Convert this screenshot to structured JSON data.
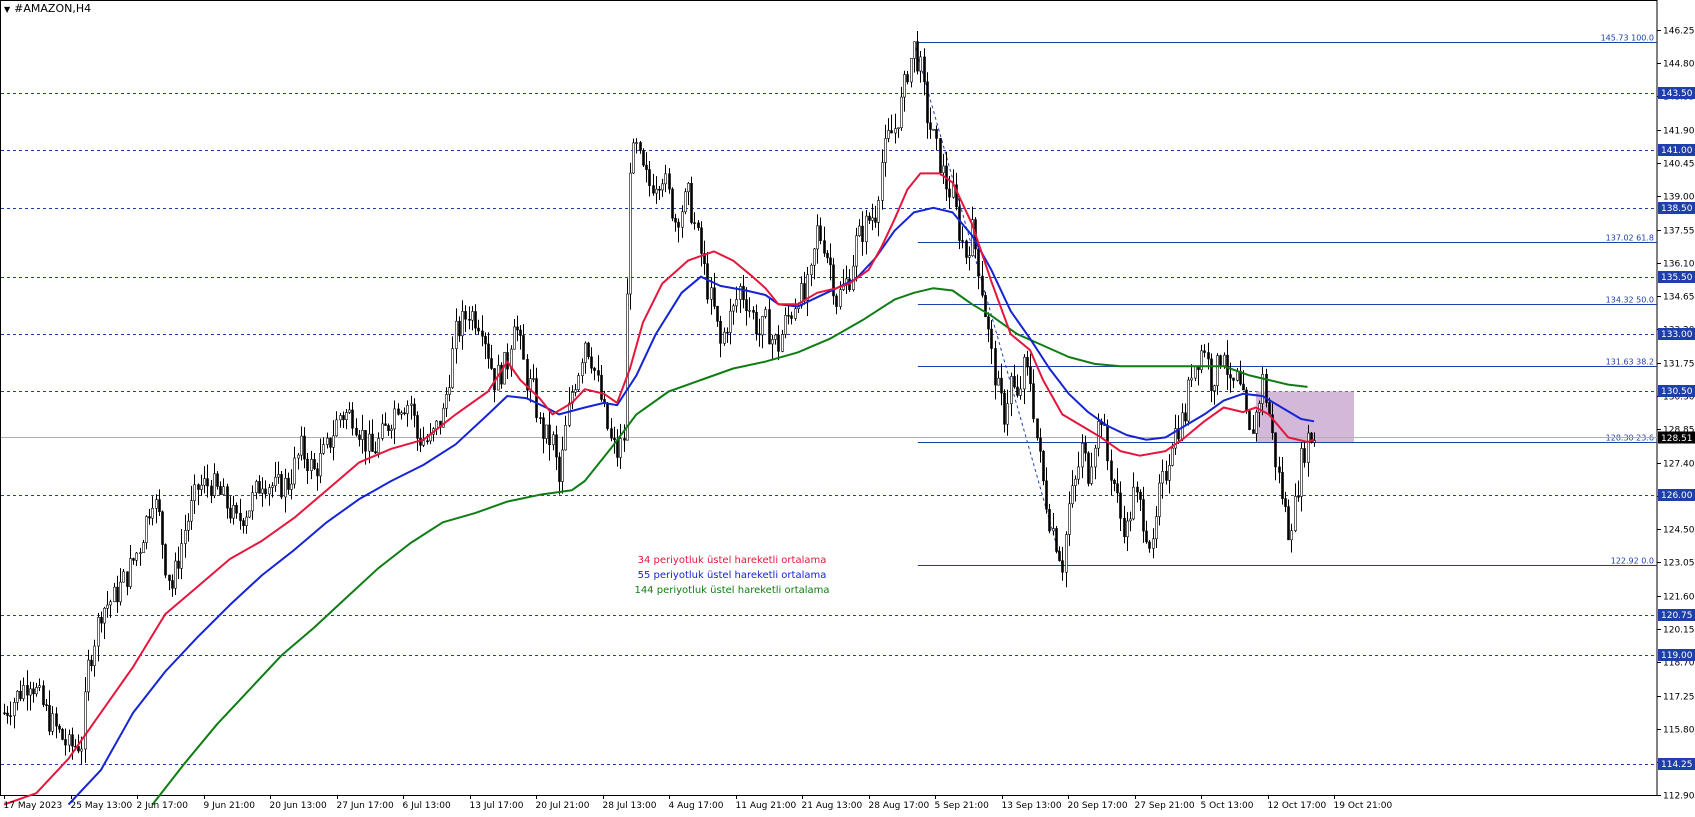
{
  "window": {
    "title": "#AMAZON,H4"
  },
  "chart_data": {
    "type": "candlestick",
    "symbol": "#AMAZON",
    "timeframe": "H4",
    "colors": {
      "ema34": "#e5163c",
      "ema55": "#1524d4",
      "ema144": "#0f7d14",
      "level": "#1f3fa8",
      "fib": "#1f3fa8",
      "zone": "#c9a6cf",
      "candle": "#000000",
      "current_price": "#ffffff"
    },
    "ylim": [
      112.92,
      146.9
    ],
    "y_ticks": [
      "146.25",
      "144.80",
      "143.35",
      "141.90",
      "140.45",
      "139.00",
      "137.55",
      "136.10",
      "134.65",
      "133.20",
      "131.75",
      "130.30",
      "128.85",
      "127.40",
      "125.95",
      "124.50",
      "123.05",
      "121.60",
      "120.15",
      "118.70",
      "117.25",
      "115.80",
      "114.35",
      "112.90"
    ],
    "x_ticks": [
      "17 May 2023",
      "25 May 13:00",
      "2 Jun 17:00",
      "9 Jun 21:00",
      "20 Jun 13:00",
      "27 Jun 17:00",
      "6 Jul 13:00",
      "13 Jul 17:00",
      "20 Jul 21:00",
      "28 Jul 13:00",
      "4 Aug 17:00",
      "11 Aug 21:00",
      "21 Aug 13:00",
      "28 Aug 17:00",
      "5 Sep 21:00",
      "13 Sep 13:00",
      "20 Sep 17:00",
      "27 Sep 21:00",
      "5 Oct 13:00",
      "12 Oct 17:00",
      "19 Oct 21:00"
    ],
    "horizontal_levels": [
      "143.50",
      "141.00",
      "138.50",
      "135.50",
      "133.00",
      "130.50",
      "126.00",
      "120.75",
      "119.00",
      "114.25"
    ],
    "fibonacci": [
      {
        "label": "145.73 100.0",
        "price": 145.73
      },
      {
        "label": "137.02 61.8",
        "price": 137.02
      },
      {
        "label": "134.32 50.0",
        "price": 134.32
      },
      {
        "label": "131.63 38.2",
        "price": 131.63
      },
      {
        "label": "128.30 23.6",
        "price": 128.3
      },
      {
        "label": "122.92 0.0",
        "price": 122.92
      }
    ],
    "current_price": "128.51",
    "legend": [
      {
        "text": "34 periyotluk üstel hareketli ortalama",
        "color": "#e5163c"
      },
      {
        "text": "55 periyotluk üstel hareketli ortalama",
        "color": "#1524d4"
      },
      {
        "text": "144 periyotluk üstel hareketli ortalama",
        "color": "#0f7d14"
      }
    ],
    "close_path": [
      [
        0,
        116.5
      ],
      [
        8,
        118.0
      ],
      [
        14,
        116.2
      ],
      [
        20,
        115.0
      ],
      [
        24,
        115.2
      ],
      [
        26,
        118.5
      ],
      [
        30,
        121.0
      ],
      [
        34,
        121.5
      ],
      [
        38,
        122.5
      ],
      [
        42,
        123.8
      ],
      [
        46,
        126.0
      ],
      [
        48,
        125.0
      ],
      [
        50,
        123.0
      ],
      [
        52,
        122.0
      ],
      [
        56,
        124.5
      ],
      [
        60,
        126.3
      ],
      [
        64,
        126.5
      ],
      [
        68,
        125.8
      ],
      [
        72,
        124.8
      ],
      [
        76,
        125.5
      ],
      [
        80,
        126.7
      ],
      [
        84,
        126.3
      ],
      [
        88,
        126.5
      ],
      [
        92,
        128.0
      ],
      [
        96,
        127.0
      ],
      [
        100,
        128.0
      ],
      [
        104,
        129.5
      ],
      [
        108,
        129.5
      ],
      [
        112,
        128.3
      ],
      [
        114,
        127.8
      ],
      [
        118,
        128.8
      ],
      [
        122,
        130.0
      ],
      [
        126,
        130.0
      ],
      [
        128,
        128.5
      ],
      [
        132,
        128.3
      ],
      [
        136,
        129.5
      ],
      [
        140,
        133.0
      ],
      [
        144,
        134.0
      ],
      [
        148,
        133.5
      ],
      [
        152,
        131.0
      ],
      [
        156,
        131.8
      ],
      [
        158,
        133.8
      ],
      [
        162,
        131.0
      ],
      [
        164,
        130.5
      ],
      [
        166,
        129.0
      ],
      [
        168,
        128.5
      ],
      [
        170,
        128.3
      ],
      [
        172,
        126.5
      ],
      [
        174,
        128.8
      ],
      [
        176,
        130.5
      ],
      [
        178,
        131.5
      ],
      [
        180,
        132.8
      ],
      [
        182,
        132.0
      ],
      [
        184,
        130.8
      ],
      [
        186,
        129.5
      ],
      [
        188,
        128.3
      ],
      [
        190,
        127.8
      ],
      [
        192,
        128.5
      ],
      [
        194,
        140.5
      ],
      [
        196,
        141.0
      ],
      [
        198,
        140.0
      ],
      [
        200,
        139.5
      ],
      [
        204,
        140.0
      ],
      [
        208,
        138.0
      ],
      [
        212,
        139.0
      ],
      [
        216,
        136.5
      ],
      [
        218,
        135.0
      ],
      [
        220,
        134.0
      ],
      [
        222,
        132.5
      ],
      [
        224,
        133.5
      ],
      [
        226,
        134.0
      ],
      [
        228,
        135.0
      ],
      [
        230,
        134.5
      ],
      [
        232,
        133.8
      ],
      [
        234,
        133.0
      ],
      [
        236,
        133.5
      ],
      [
        238,
        132.8
      ],
      [
        240,
        132.5
      ],
      [
        242,
        133.5
      ],
      [
        244,
        134.0
      ],
      [
        246,
        134.8
      ],
      [
        248,
        134.5
      ],
      [
        250,
        135.5
      ],
      [
        252,
        137.5
      ],
      [
        254,
        137.0
      ],
      [
        256,
        136.0
      ],
      [
        258,
        134.5
      ],
      [
        260,
        135.0
      ],
      [
        262,
        135.5
      ],
      [
        264,
        137.0
      ],
      [
        266,
        137.5
      ],
      [
        268,
        138.0
      ],
      [
        270,
        138.3
      ],
      [
        272,
        140.5
      ],
      [
        274,
        141.5
      ],
      [
        276,
        142.0
      ],
      [
        278,
        143.0
      ],
      [
        280,
        144.5
      ],
      [
        282,
        145.5
      ],
      [
        284,
        144.5
      ],
      [
        286,
        142.5
      ],
      [
        288,
        141.5
      ],
      [
        290,
        140.5
      ],
      [
        292,
        139.5
      ],
      [
        294,
        139.0
      ],
      [
        296,
        137.5
      ],
      [
        298,
        136.5
      ],
      [
        300,
        137.5
      ],
      [
        302,
        136.0
      ],
      [
        304,
        134.0
      ],
      [
        306,
        132.0
      ],
      [
        308,
        130.5
      ],
      [
        310,
        129.5
      ],
      [
        312,
        131.0
      ],
      [
        314,
        130.0
      ],
      [
        316,
        131.5
      ],
      [
        318,
        131.0
      ],
      [
        320,
        128.5
      ],
      [
        322,
        126.5
      ],
      [
        324,
        125.0
      ],
      [
        326,
        124.0
      ],
      [
        328,
        123.0
      ],
      [
        330,
        125.5
      ],
      [
        332,
        126.5
      ],
      [
        334,
        128.0
      ],
      [
        336,
        127.0
      ],
      [
        338,
        128.5
      ],
      [
        340,
        129.5
      ],
      [
        342,
        127.5
      ],
      [
        344,
        126.5
      ],
      [
        346,
        125.0
      ],
      [
        348,
        124.5
      ],
      [
        350,
        126.0
      ],
      [
        352,
        125.5
      ],
      [
        354,
        124.5
      ],
      [
        356,
        123.5
      ],
      [
        358,
        126.0
      ],
      [
        360,
        127.0
      ],
      [
        362,
        128.5
      ],
      [
        364,
        129.0
      ],
      [
        366,
        129.5
      ],
      [
        368,
        131.5
      ],
      [
        370,
        132.0
      ],
      [
        372,
        132.5
      ],
      [
        374,
        131.0
      ],
      [
        376,
        131.5
      ],
      [
        378,
        132.5
      ],
      [
        380,
        130.5
      ],
      [
        382,
        131.0
      ],
      [
        384,
        130.0
      ],
      [
        386,
        128.5
      ],
      [
        388,
        129.5
      ],
      [
        390,
        131.0
      ],
      [
        392,
        129.5
      ],
      [
        394,
        127.5
      ],
      [
        396,
        126.0
      ],
      [
        398,
        124.5
      ],
      [
        400,
        125.5
      ],
      [
        402,
        127.5
      ],
      [
        404,
        128.5
      ],
      [
        406,
        128.51
      ]
    ],
    "ema34_path": [
      [
        0,
        112.5
      ],
      [
        10,
        113.0
      ],
      [
        20,
        114.5
      ],
      [
        30,
        116.5
      ],
      [
        40,
        118.5
      ],
      [
        50,
        120.8
      ],
      [
        60,
        122.0
      ],
      [
        70,
        123.2
      ],
      [
        80,
        124.0
      ],
      [
        90,
        125.0
      ],
      [
        100,
        126.2
      ],
      [
        110,
        127.4
      ],
      [
        120,
        128.0
      ],
      [
        130,
        128.4
      ],
      [
        140,
        129.5
      ],
      [
        150,
        130.5
      ],
      [
        156,
        131.8
      ],
      [
        160,
        131.0
      ],
      [
        166,
        130.2
      ],
      [
        170,
        129.5
      ],
      [
        176,
        130.0
      ],
      [
        180,
        130.6
      ],
      [
        186,
        130.4
      ],
      [
        190,
        130.0
      ],
      [
        194,
        131.5
      ],
      [
        198,
        133.5
      ],
      [
        204,
        135.2
      ],
      [
        212,
        136.2
      ],
      [
        220,
        136.6
      ],
      [
        226,
        136.2
      ],
      [
        232,
        135.5
      ],
      [
        236,
        135.0
      ],
      [
        240,
        134.3
      ],
      [
        246,
        134.3
      ],
      [
        252,
        134.8
      ],
      [
        258,
        135.0
      ],
      [
        262,
        135.2
      ],
      [
        268,
        135.8
      ],
      [
        272,
        136.8
      ],
      [
        276,
        138.0
      ],
      [
        280,
        139.3
      ],
      [
        284,
        140.0
      ],
      [
        290,
        140.0
      ],
      [
        294,
        139.6
      ],
      [
        300,
        137.8
      ],
      [
        306,
        135.3
      ],
      [
        312,
        133.0
      ],
      [
        318,
        132.3
      ],
      [
        322,
        131.0
      ],
      [
        328,
        129.5
      ],
      [
        334,
        129.0
      ],
      [
        340,
        128.5
      ],
      [
        346,
        127.9
      ],
      [
        352,
        127.7
      ],
      [
        360,
        127.9
      ],
      [
        366,
        128.5
      ],
      [
        372,
        129.2
      ],
      [
        378,
        129.8
      ],
      [
        384,
        129.6
      ],
      [
        388,
        129.8
      ],
      [
        392,
        129.5
      ],
      [
        398,
        128.5
      ],
      [
        404,
        128.3
      ],
      [
        406,
        128.4
      ]
    ],
    "ema55_path": [
      [
        20,
        112.5
      ],
      [
        30,
        114.0
      ],
      [
        40,
        116.5
      ],
      [
        50,
        118.3
      ],
      [
        60,
        119.8
      ],
      [
        70,
        121.2
      ],
      [
        80,
        122.5
      ],
      [
        90,
        123.6
      ],
      [
        100,
        124.8
      ],
      [
        110,
        125.8
      ],
      [
        120,
        126.6
      ],
      [
        130,
        127.3
      ],
      [
        140,
        128.2
      ],
      [
        150,
        129.5
      ],
      [
        156,
        130.3
      ],
      [
        162,
        130.2
      ],
      [
        168,
        129.8
      ],
      [
        172,
        129.5
      ],
      [
        180,
        129.8
      ],
      [
        186,
        130.0
      ],
      [
        190,
        129.9
      ],
      [
        196,
        131.2
      ],
      [
        202,
        133.0
      ],
      [
        210,
        134.8
      ],
      [
        216,
        135.5
      ],
      [
        222,
        135.1
      ],
      [
        230,
        134.9
      ],
      [
        236,
        134.7
      ],
      [
        240,
        134.3
      ],
      [
        246,
        134.2
      ],
      [
        252,
        134.6
      ],
      [
        258,
        135.0
      ],
      [
        264,
        135.4
      ],
      [
        270,
        136.3
      ],
      [
        276,
        137.5
      ],
      [
        282,
        138.3
      ],
      [
        288,
        138.5
      ],
      [
        294,
        138.3
      ],
      [
        300,
        137.3
      ],
      [
        306,
        135.8
      ],
      [
        312,
        134.0
      ],
      [
        318,
        132.8
      ],
      [
        324,
        131.5
      ],
      [
        330,
        130.4
      ],
      [
        336,
        129.6
      ],
      [
        342,
        129.0
      ],
      [
        348,
        128.6
      ],
      [
        354,
        128.4
      ],
      [
        360,
        128.5
      ],
      [
        366,
        129.0
      ],
      [
        372,
        129.5
      ],
      [
        378,
        130.1
      ],
      [
        384,
        130.4
      ],
      [
        390,
        130.3
      ],
      [
        396,
        129.8
      ],
      [
        402,
        129.3
      ],
      [
        406,
        129.2
      ]
    ],
    "ema144_path": [
      [
        46,
        112.5
      ],
      [
        56,
        114.3
      ],
      [
        66,
        116.0
      ],
      [
        76,
        117.5
      ],
      [
        86,
        119.0
      ],
      [
        96,
        120.2
      ],
      [
        106,
        121.5
      ],
      [
        116,
        122.8
      ],
      [
        126,
        123.9
      ],
      [
        136,
        124.8
      ],
      [
        146,
        125.2
      ],
      [
        156,
        125.7
      ],
      [
        166,
        126.0
      ],
      [
        176,
        126.2
      ],
      [
        180,
        126.6
      ],
      [
        188,
        128.0
      ],
      [
        196,
        129.5
      ],
      [
        206,
        130.5
      ],
      [
        216,
        131.0
      ],
      [
        226,
        131.5
      ],
      [
        236,
        131.8
      ],
      [
        246,
        132.2
      ],
      [
        256,
        132.8
      ],
      [
        266,
        133.6
      ],
      [
        276,
        134.5
      ],
      [
        282,
        134.8
      ],
      [
        288,
        135.0
      ],
      [
        294,
        134.9
      ],
      [
        300,
        134.3
      ],
      [
        306,
        133.8
      ],
      [
        314,
        133.0
      ],
      [
        322,
        132.5
      ],
      [
        330,
        132.0
      ],
      [
        338,
        131.7
      ],
      [
        346,
        131.6
      ],
      [
        354,
        131.6
      ],
      [
        362,
        131.6
      ],
      [
        370,
        131.6
      ],
      [
        378,
        131.6
      ],
      [
        386,
        131.2
      ],
      [
        392,
        131.0
      ],
      [
        398,
        130.8
      ],
      [
        404,
        130.7
      ]
    ]
  }
}
